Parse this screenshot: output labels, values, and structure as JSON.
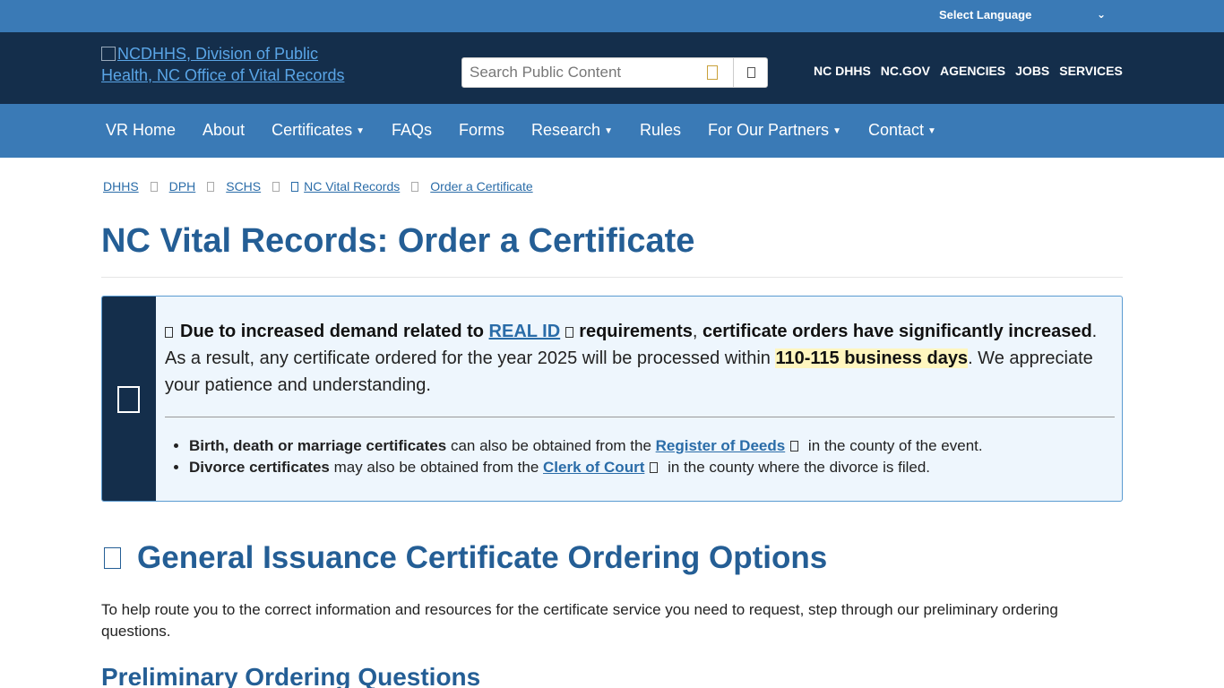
{
  "language_bar": {
    "label": "Select Language",
    "chevron_icon": "chevron-down-icon"
  },
  "header": {
    "logo_alt": "NCDHHS, Division of Public Health, NC Office of Vital Records",
    "search_placeholder": "Search Public Content",
    "utility_nav": [
      "NC DHHS",
      "NC.GOV",
      "AGENCIES",
      "JOBS",
      "SERVICES"
    ]
  },
  "main_nav": [
    {
      "label": "VR Home",
      "dropdown": false
    },
    {
      "label": "About",
      "dropdown": false
    },
    {
      "label": "Certificates",
      "dropdown": true
    },
    {
      "label": "FAQs",
      "dropdown": false
    },
    {
      "label": "Forms",
      "dropdown": false
    },
    {
      "label": "Research",
      "dropdown": true
    },
    {
      "label": "Rules",
      "dropdown": false
    },
    {
      "label": "For Our Partners",
      "dropdown": true
    },
    {
      "label": "Contact",
      "dropdown": true
    }
  ],
  "breadcrumb": [
    "DHHS",
    "DPH",
    "SCHS",
    "NC Vital Records",
    "Order a Certificate"
  ],
  "page_title": "NC Vital Records: Order a Certificate",
  "alert": {
    "part1": "Due to increased demand related to",
    "real_id_link": "REAL ID",
    "part2": "requirements",
    "part3": ", ",
    "part4": "certificate orders have significantly increased",
    "part5": ". As a result, any certificate ordered for the year 2025 will be processed within ",
    "highlight": "110-115 business days",
    "part6": ". We appreciate your patience and understanding.",
    "bullets": [
      {
        "bold": "Birth, death or marriage certificates",
        "pre": " can also be obtained from the ",
        "link": "Register of Deeds",
        "post": " in the county of the event."
      },
      {
        "bold": "Divorce certificates",
        "pre": " may also be obtained from the ",
        "link": "Clerk of Court",
        "post": " in the county where the divorce is filed."
      }
    ]
  },
  "section_heading": "General Issuance Certificate Ordering Options",
  "section_intro": "To help route you to the correct information and resources for the certificate service you need to request, step through our preliminary ordering questions.",
  "subheading": "Preliminary Ordering Questions",
  "colors": {
    "top_bar": "#3a7ab6",
    "header_bg": "#142e4b",
    "heading": "#245e95",
    "link": "#2a6ca8"
  }
}
